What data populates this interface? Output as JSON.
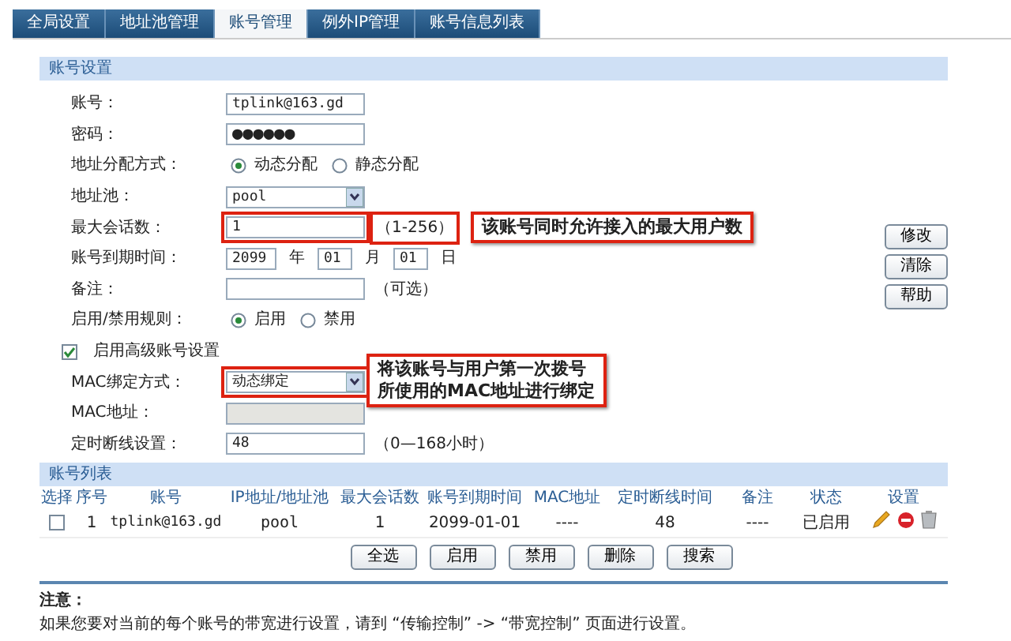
{
  "tabs": [
    {
      "label": "全局设置",
      "selected": false
    },
    {
      "label": "地址池管理",
      "selected": false
    },
    {
      "label": "账号管理",
      "selected": true
    },
    {
      "label": "例外IP管理",
      "selected": false
    },
    {
      "label": "账号信息列表",
      "selected": false
    }
  ],
  "account_settings": {
    "title": "账号设置",
    "fields": [
      {
        "kind": "text",
        "label": "账号：",
        "value": "tplink@163.gd"
      },
      {
        "kind": "text",
        "label": "密码：",
        "value": "●●●●●●"
      },
      {
        "kind": "radio",
        "label": "地址分配方式：",
        "options": [
          {
            "label": "动态分配",
            "selected": true
          },
          {
            "label": "静态分配",
            "selected": false
          }
        ]
      },
      {
        "kind": "select",
        "label": "地址池：",
        "value": "pool"
      },
      {
        "kind": "text",
        "label": "最大会话数：",
        "value": "1",
        "hint": "（1-256）",
        "highlighted": true,
        "annotation": [
          "该账号同时允许接入的最大用户数"
        ]
      },
      {
        "kind": "date",
        "label": "账号到期时间：",
        "parts": [
          {
            "value": "2099",
            "unit": "年"
          },
          {
            "value": "01",
            "unit": "月"
          },
          {
            "value": "01",
            "unit": "日"
          }
        ]
      },
      {
        "kind": "text",
        "label": "备注：",
        "hint": "（可选）"
      },
      {
        "kind": "radio",
        "label": "启用/禁用规则：",
        "options": [
          {
            "label": "启用",
            "selected": true
          },
          {
            "label": "禁用",
            "selected": false
          }
        ]
      },
      {
        "kind": "checkbox",
        "label": "启用高级账号设置",
        "checked": true
      },
      {
        "kind": "select",
        "label": "MAC绑定方式：",
        "value": "动态绑定",
        "highlighted": true,
        "annotation": [
          "将该账号与用户第一次拨号",
          "所使用的MAC地址进行绑定"
        ]
      },
      {
        "kind": "text",
        "label": "MAC地址：",
        "disabled": true
      },
      {
        "kind": "text",
        "label": "定时断线设置：",
        "value": "48",
        "hint": "（0—168小时）"
      }
    ],
    "side_buttons": [
      "修改",
      "清除",
      "帮助"
    ]
  },
  "account_list": {
    "title": "账号列表",
    "columns": [
      "选择",
      "序号",
      "账号",
      "IP地址/地址池",
      "最大会话数",
      "账号到期时间",
      "MAC地址",
      "定时断线时间",
      "备注",
      "状态",
      "设置"
    ],
    "rows": [
      {
        "checked": false,
        "cells": [
          "",
          "1",
          "tplink@163.gd",
          "pool",
          "1",
          "2099-01-01",
          "----",
          "48",
          "----",
          "已启用"
        ]
      }
    ],
    "buttons": [
      "全选",
      "启用",
      "禁用",
      "删除",
      "搜索"
    ]
  },
  "note": {
    "title": "注意：",
    "text": "如果您要对当前的每个账号的带宽进行设置，请到 “传输控制” -> “带宽控制” 页面进行设置。"
  }
}
